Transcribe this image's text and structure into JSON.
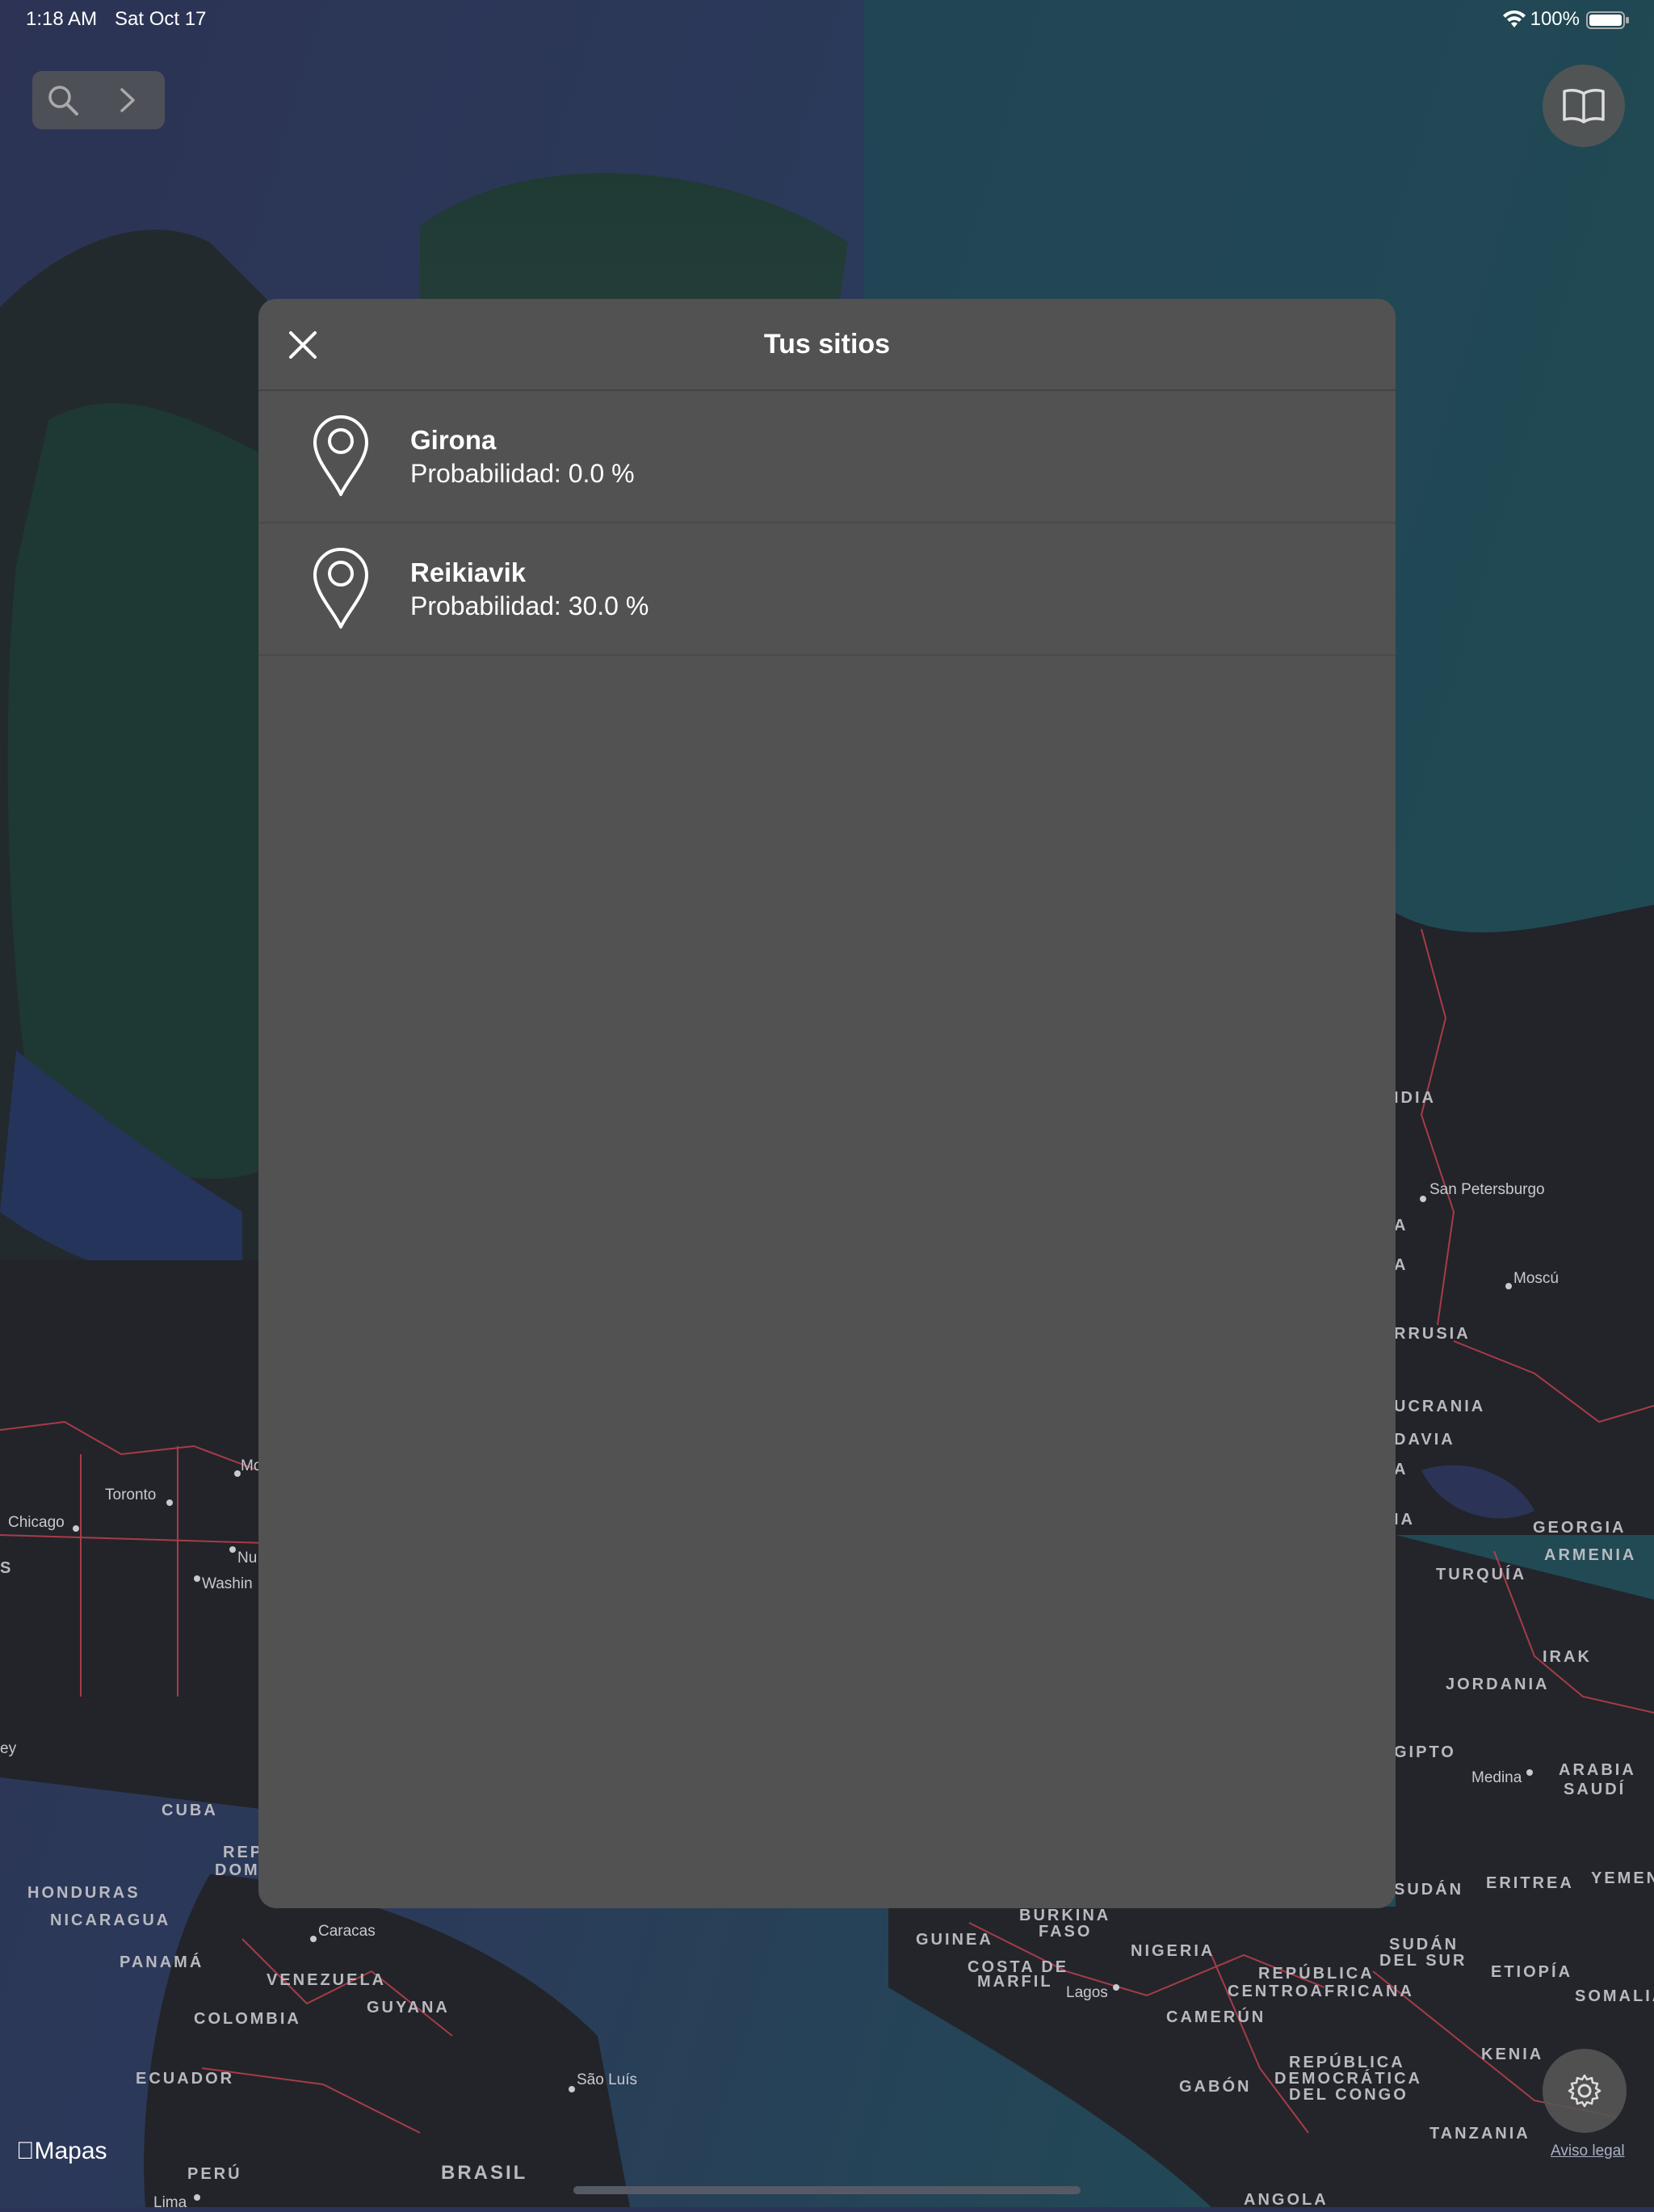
{
  "status_bar": {
    "time": "1:18 AM",
    "date": "Sat Oct 17",
    "battery": "100%"
  },
  "toolbar": {
    "search_icon": "search-icon",
    "forward_icon": "chevron-right-icon",
    "book_icon": "book-icon"
  },
  "modal": {
    "title": "Tus sitios",
    "close_icon": "close-icon",
    "places": [
      {
        "name": "Girona",
        "probability": "Probabilidad: 0.0 %"
      },
      {
        "name": "Reikiavik",
        "probability": "Probabilidad: 30.0 %"
      }
    ]
  },
  "map": {
    "countries": [
      "IDIA",
      "A",
      "A",
      "RRUSIA",
      "UCRANIA",
      "DAVIA",
      "A",
      "IA",
      "GEORGIA",
      "ARMENIA",
      "TURQUÍA",
      "IRAK",
      "JORDANIA",
      "GIPTO",
      "ARABIA",
      "SAUDÍ",
      "SUDÁN",
      "ERITREA",
      "YEMEN",
      "S",
      "CUBA",
      "REP.",
      "DOM.",
      "HONDURAS",
      "NICARAGUA",
      "PANAMÁ",
      "VENEZUELA",
      "GUYANA",
      "COLOMBIA",
      "ECUADOR",
      "PERÚ",
      "BRASIL",
      "GUINEA",
      "COSTA DE",
      "MARFIL",
      "BURKINA",
      "FASO",
      "NIGERIA",
      "CAMERÚN",
      "REPÚBLICA",
      "CENTROAFRICANA",
      "SUDÁN",
      "DEL SUR",
      "ETIOPÍA",
      "SOMALIA",
      "KENIA",
      "GABÓN",
      "REPÚBLICA",
      "DEMOCRÁTICA",
      "DEL CONGO",
      "TANZANIA",
      "ANGOLA"
    ],
    "cities": [
      "San Petersburgo",
      "Moscú",
      "Medina",
      "Toronto",
      "Chicago",
      "Mo",
      "Nu",
      "Washin",
      "ey",
      "Caracas",
      "São Luís",
      "Lagos",
      "Lima"
    ]
  },
  "settings_icon": "gear-icon",
  "legal_link": "Aviso legal",
  "maps_logo": "Mapas"
}
